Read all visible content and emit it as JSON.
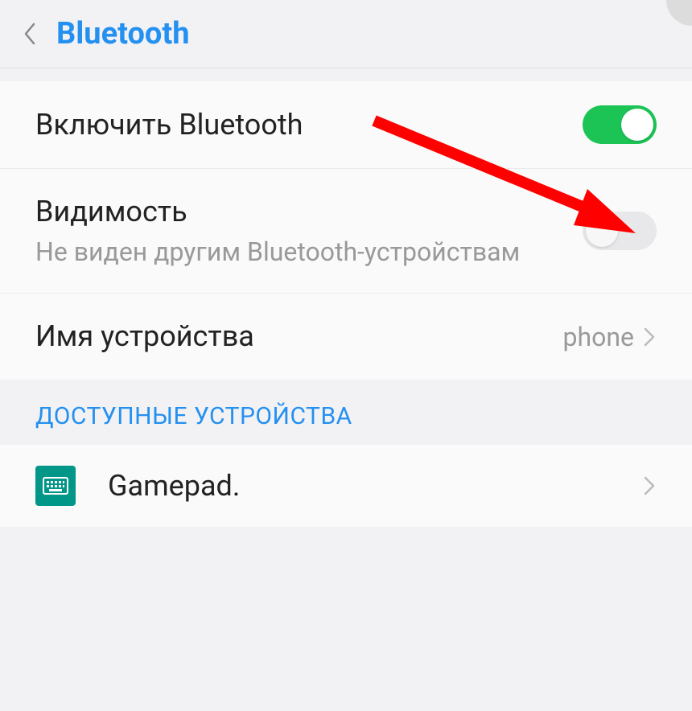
{
  "header": {
    "title": "Bluetooth"
  },
  "settings": {
    "enable_bt": {
      "title": "Включить Bluetooth",
      "enabled": true
    },
    "visibility": {
      "title": "Видимость",
      "subtitle": "Не виден другим Bluetooth-устройствам",
      "enabled": false
    },
    "device_name": {
      "title": "Имя устройства",
      "value": "phone"
    }
  },
  "available_section": {
    "header": "ДОСТУПНЫЕ УСТРОЙСТВА",
    "devices": [
      {
        "name": "Gamepad.",
        "icon": "keyboard"
      }
    ]
  }
}
